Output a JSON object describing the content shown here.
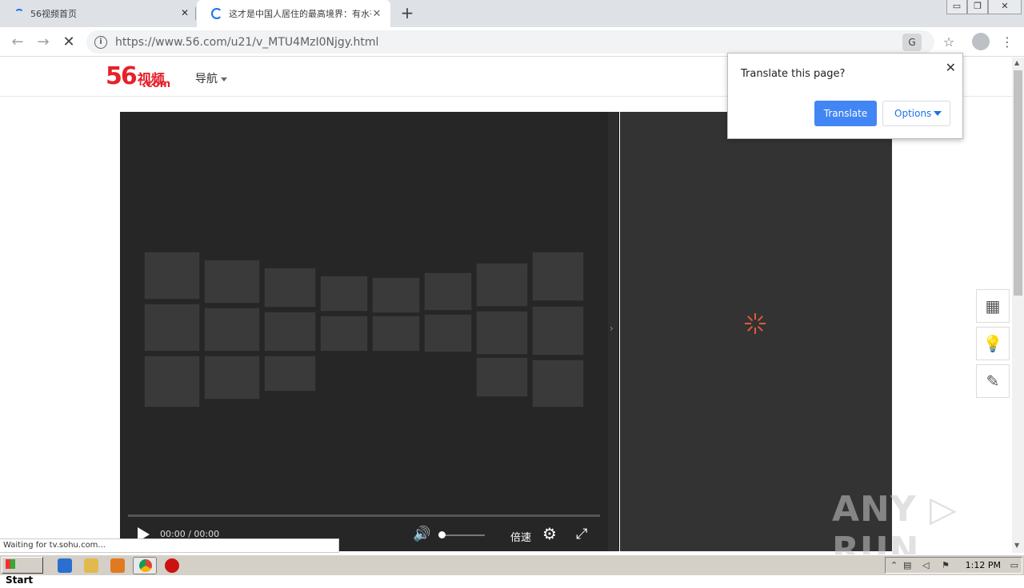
{
  "tabs": [
    {
      "title": "56视频首页",
      "close": "✕"
    },
    {
      "title": "这才是中国人居住的最高境界：有水有...",
      "close": "✕"
    }
  ],
  "newtab": "+",
  "window_controls": [
    "▭",
    "❐",
    "✕"
  ],
  "toolbar": {
    "back": "←",
    "forward": "→",
    "reload": "✕",
    "info": "i",
    "url_host": "https://www.56.com",
    "url_path": "/u21/v_MTU4MzI0Njgy.html",
    "translate_icon": "G",
    "star": "☆",
    "menu": "⋮"
  },
  "site": {
    "logo_number": "56",
    "logo_cn": "视频",
    "logo_com": ".com",
    "nav_label": "导航"
  },
  "player": {
    "time": "00:00 / 00:00",
    "speed_label": "倍速",
    "volume_icon": "🔊",
    "settings_icon": "⚙",
    "fullscreen_icon": "⤢",
    "volume_level": 0.05,
    "progress": 0
  },
  "side_toggle": "›",
  "float_tools": [
    "▦",
    "💡",
    "✎"
  ],
  "translate_bubble": {
    "question": "Translate this page?",
    "translate_button": "Translate",
    "options_button": "Options",
    "close": "✕"
  },
  "status_text": "Waiting for tv.sohu.com...",
  "watermark": "ANY ▷ RUN",
  "taskbar": {
    "start_label": "Start",
    "clock": "1:12 PM"
  },
  "colors": {
    "brand_red": "#e6212a",
    "translate_blue": "#4285f4",
    "player_bg": "#262626",
    "sidepanel_bg": "#333333"
  }
}
